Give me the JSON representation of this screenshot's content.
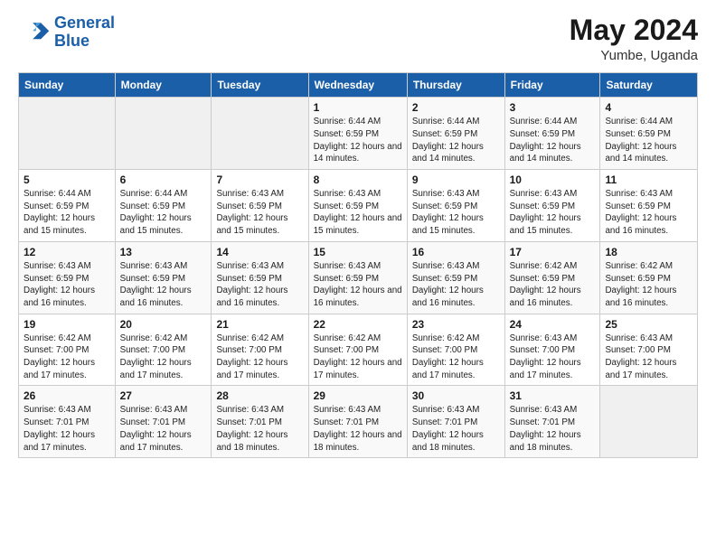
{
  "logo": {
    "line1": "General",
    "line2": "Blue"
  },
  "title": {
    "month_year": "May 2024",
    "location": "Yumbe, Uganda"
  },
  "days_of_week": [
    "Sunday",
    "Monday",
    "Tuesday",
    "Wednesday",
    "Thursday",
    "Friday",
    "Saturday"
  ],
  "weeks": [
    [
      {
        "day": "",
        "info": ""
      },
      {
        "day": "",
        "info": ""
      },
      {
        "day": "",
        "info": ""
      },
      {
        "day": "1",
        "info": "Sunrise: 6:44 AM\nSunset: 6:59 PM\nDaylight: 12 hours and 14 minutes."
      },
      {
        "day": "2",
        "info": "Sunrise: 6:44 AM\nSunset: 6:59 PM\nDaylight: 12 hours and 14 minutes."
      },
      {
        "day": "3",
        "info": "Sunrise: 6:44 AM\nSunset: 6:59 PM\nDaylight: 12 hours and 14 minutes."
      },
      {
        "day": "4",
        "info": "Sunrise: 6:44 AM\nSunset: 6:59 PM\nDaylight: 12 hours and 14 minutes."
      }
    ],
    [
      {
        "day": "5",
        "info": "Sunrise: 6:44 AM\nSunset: 6:59 PM\nDaylight: 12 hours and 15 minutes."
      },
      {
        "day": "6",
        "info": "Sunrise: 6:44 AM\nSunset: 6:59 PM\nDaylight: 12 hours and 15 minutes."
      },
      {
        "day": "7",
        "info": "Sunrise: 6:43 AM\nSunset: 6:59 PM\nDaylight: 12 hours and 15 minutes."
      },
      {
        "day": "8",
        "info": "Sunrise: 6:43 AM\nSunset: 6:59 PM\nDaylight: 12 hours and 15 minutes."
      },
      {
        "day": "9",
        "info": "Sunrise: 6:43 AM\nSunset: 6:59 PM\nDaylight: 12 hours and 15 minutes."
      },
      {
        "day": "10",
        "info": "Sunrise: 6:43 AM\nSunset: 6:59 PM\nDaylight: 12 hours and 15 minutes."
      },
      {
        "day": "11",
        "info": "Sunrise: 6:43 AM\nSunset: 6:59 PM\nDaylight: 12 hours and 16 minutes."
      }
    ],
    [
      {
        "day": "12",
        "info": "Sunrise: 6:43 AM\nSunset: 6:59 PM\nDaylight: 12 hours and 16 minutes."
      },
      {
        "day": "13",
        "info": "Sunrise: 6:43 AM\nSunset: 6:59 PM\nDaylight: 12 hours and 16 minutes."
      },
      {
        "day": "14",
        "info": "Sunrise: 6:43 AM\nSunset: 6:59 PM\nDaylight: 12 hours and 16 minutes."
      },
      {
        "day": "15",
        "info": "Sunrise: 6:43 AM\nSunset: 6:59 PM\nDaylight: 12 hours and 16 minutes."
      },
      {
        "day": "16",
        "info": "Sunrise: 6:43 AM\nSunset: 6:59 PM\nDaylight: 12 hours and 16 minutes."
      },
      {
        "day": "17",
        "info": "Sunrise: 6:42 AM\nSunset: 6:59 PM\nDaylight: 12 hours and 16 minutes."
      },
      {
        "day": "18",
        "info": "Sunrise: 6:42 AM\nSunset: 6:59 PM\nDaylight: 12 hours and 16 minutes."
      }
    ],
    [
      {
        "day": "19",
        "info": "Sunrise: 6:42 AM\nSunset: 7:00 PM\nDaylight: 12 hours and 17 minutes."
      },
      {
        "day": "20",
        "info": "Sunrise: 6:42 AM\nSunset: 7:00 PM\nDaylight: 12 hours and 17 minutes."
      },
      {
        "day": "21",
        "info": "Sunrise: 6:42 AM\nSunset: 7:00 PM\nDaylight: 12 hours and 17 minutes."
      },
      {
        "day": "22",
        "info": "Sunrise: 6:42 AM\nSunset: 7:00 PM\nDaylight: 12 hours and 17 minutes."
      },
      {
        "day": "23",
        "info": "Sunrise: 6:42 AM\nSunset: 7:00 PM\nDaylight: 12 hours and 17 minutes."
      },
      {
        "day": "24",
        "info": "Sunrise: 6:43 AM\nSunset: 7:00 PM\nDaylight: 12 hours and 17 minutes."
      },
      {
        "day": "25",
        "info": "Sunrise: 6:43 AM\nSunset: 7:00 PM\nDaylight: 12 hours and 17 minutes."
      }
    ],
    [
      {
        "day": "26",
        "info": "Sunrise: 6:43 AM\nSunset: 7:01 PM\nDaylight: 12 hours and 17 minutes."
      },
      {
        "day": "27",
        "info": "Sunrise: 6:43 AM\nSunset: 7:01 PM\nDaylight: 12 hours and 17 minutes."
      },
      {
        "day": "28",
        "info": "Sunrise: 6:43 AM\nSunset: 7:01 PM\nDaylight: 12 hours and 18 minutes."
      },
      {
        "day": "29",
        "info": "Sunrise: 6:43 AM\nSunset: 7:01 PM\nDaylight: 12 hours and 18 minutes."
      },
      {
        "day": "30",
        "info": "Sunrise: 6:43 AM\nSunset: 7:01 PM\nDaylight: 12 hours and 18 minutes."
      },
      {
        "day": "31",
        "info": "Sunrise: 6:43 AM\nSunset: 7:01 PM\nDaylight: 12 hours and 18 minutes."
      },
      {
        "day": "",
        "info": ""
      }
    ]
  ]
}
